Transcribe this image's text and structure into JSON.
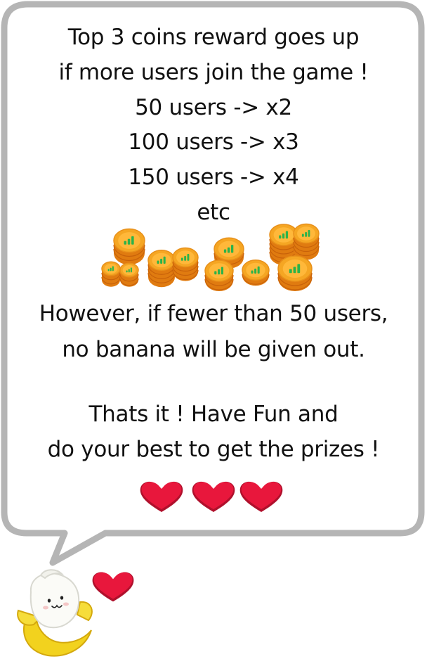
{
  "message": {
    "lines": [
      "Top 3 coins reward goes up",
      "if more users join the game !",
      "50 users -> x2",
      "100 users -> x3",
      "150 users -> x4",
      "etc",
      "However, if fewer than 50 users,",
      "no banana will be given out.",
      "Thats it ! Have Fun and",
      "do your best to get the prizes !"
    ]
  },
  "decorations": {
    "coin_icon": "coin-stack-icon",
    "heart_icon": "heart-icon",
    "mascot": "banana-mascot",
    "colors": {
      "bubble_border": "#b5b5b5",
      "coin_gold": "#f5a623",
      "coin_edge": "#e07b10",
      "coin_chart": "#2bb34a",
      "heart": "#e8173c"
    }
  }
}
